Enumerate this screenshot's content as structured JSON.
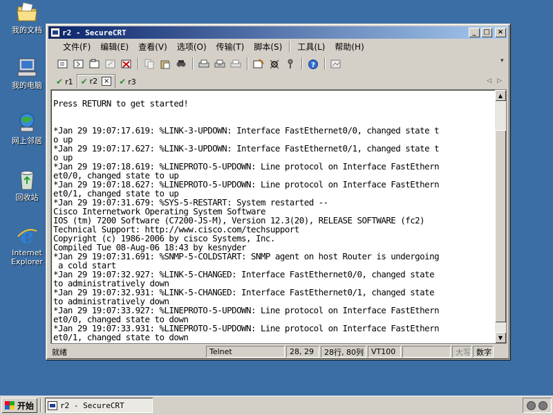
{
  "desktop": {
    "icons": [
      {
        "label": "我的文档",
        "icon": "my-documents-icon"
      },
      {
        "label": "我的电脑",
        "icon": "my-computer-icon"
      },
      {
        "label": "网上邻居",
        "icon": "network-places-icon"
      },
      {
        "label": "回收站",
        "icon": "recycle-bin-icon"
      },
      {
        "label": "Internet\nExplorer",
        "icon": "internet-explorer-icon"
      }
    ]
  },
  "window": {
    "title": "r2 - SecureCRT",
    "buttons": {
      "minimize": "_",
      "maximize": "□",
      "close": "×"
    }
  },
  "menu": [
    "文件(F)",
    "编辑(E)",
    "查看(V)",
    "选项(O)",
    "传输(T)",
    "脚本(S)",
    "工具(L)",
    "帮助(H)"
  ],
  "tabs": [
    {
      "label": "r1",
      "active": false
    },
    {
      "label": "r2",
      "active": true
    },
    {
      "label": "r3",
      "active": false
    }
  ],
  "tab_close": "×",
  "tab_nav": {
    "prev": "◁",
    "next": "▷"
  },
  "terminal": {
    "text": "\nPress RETURN to get started!\n\n\n*Jan 29 19:07:17.619: %LINK-3-UPDOWN: Interface FastEthernet0/0, changed state t\no up\n*Jan 29 19:07:17.627: %LINK-3-UPDOWN: Interface FastEthernet0/1, changed state t\no up\n*Jan 29 19:07:18.619: %LINEPROTO-5-UPDOWN: Line protocol on Interface FastEthern\net0/0, changed state to up\n*Jan 29 19:07:18.627: %LINEPROTO-5-UPDOWN: Line protocol on Interface FastEthern\net0/1, changed state to up\n*Jan 29 19:07:31.679: %SYS-5-RESTART: System restarted --\nCisco Internetwork Operating System Software\nIOS (tm) 7200 Software (C7200-JS-M), Version 12.3(20), RELEASE SOFTWARE (fc2)\nTechnical Support: http://www.cisco.com/techsupport\nCopyright (c) 1986-2006 by cisco Systems, Inc.\nCompiled Tue 08-Aug-06 18:43 by kesnyder\n*Jan 29 19:07:31.691: %SNMP-5-COLDSTART: SNMP agent on host Router is undergoing\n a cold start\n*Jan 29 19:07:32.927: %LINK-5-CHANGED: Interface FastEthernet0/0, changed state\nto administratively down\n*Jan 29 19:07:32.931: %LINK-5-CHANGED: Interface FastEthernet0/1, changed state\nto administratively down\n*Jan 29 19:07:33.927: %LINEPROTO-5-UPDOWN: Line protocol on Interface FastEthern\net0/0, changed state to down\n*Jan 29 19:07:33.931: %LINEPROTO-5-UPDOWN: Line protocol on Interface FastEthern\net0/1, changed state to down"
  },
  "status": {
    "ready": "就绪",
    "protocol": "Telnet",
    "cursor": "28, 29",
    "size": "28行, 80列",
    "emulation": "VT100",
    "caps": "大写",
    "num": "数字"
  },
  "taskbar": {
    "start": "开始",
    "task": "r2 - SecureCRT"
  },
  "colors": {
    "desktop": "#3a6ea5",
    "titlebar_start": "#0a246a",
    "titlebar_end": "#a6caf0",
    "tab_check": "#2e8b2e"
  }
}
